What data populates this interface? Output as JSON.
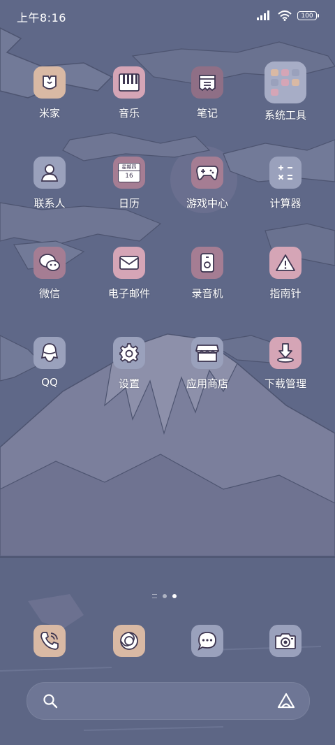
{
  "status_bar": {
    "time": "上午8:16",
    "battery": "100"
  },
  "apps": [
    {
      "label": "米家",
      "icon": "mijia-icon",
      "bg": "#d9b9a4"
    },
    {
      "label": "音乐",
      "icon": "piano-icon",
      "bg": "#d5a5b6"
    },
    {
      "label": "笔记",
      "icon": "notes-icon",
      "bg": "#8f6f86"
    },
    {
      "label": "系统工具",
      "icon": "folder-icon",
      "bg": "#a7adc6"
    },
    {
      "label": "联系人",
      "icon": "person-icon",
      "bg": "#9aa1bc"
    },
    {
      "label": "日历",
      "icon": "calendar-icon",
      "bg": "#a57d93"
    },
    {
      "label": "游戏中心",
      "icon": "gamepad-icon",
      "bg": "#a57d93"
    },
    {
      "label": "计算器",
      "icon": "calculator-icon",
      "bg": "#9aa1bc"
    },
    {
      "label": "微信",
      "icon": "wechat-icon",
      "bg": "#a57d93"
    },
    {
      "label": "电子邮件",
      "icon": "mail-icon",
      "bg": "#d5a5b6"
    },
    {
      "label": "录音机",
      "icon": "recorder-icon",
      "bg": "#a57d93"
    },
    {
      "label": "指南针",
      "icon": "compass-icon",
      "bg": "#d5a5b6"
    },
    {
      "label": "QQ",
      "icon": "qq-icon",
      "bg": "#9aa1bc"
    },
    {
      "label": "设置",
      "icon": "gear-icon",
      "bg": "#9aa1bc"
    },
    {
      "label": "应用商店",
      "icon": "store-icon",
      "bg": "#9aa1bc"
    },
    {
      "label": "下载管理",
      "icon": "download-icon",
      "bg": "#d5a5b6"
    }
  ],
  "calendar_icon": {
    "weekday": "星期四",
    "day": "16"
  },
  "dock": [
    {
      "icon": "phone-icon",
      "bg": "#d9b9a4"
    },
    {
      "icon": "browser-icon",
      "bg": "#d9b9a4"
    },
    {
      "icon": "message-icon",
      "bg": "#9aa1bc"
    },
    {
      "icon": "camera-icon",
      "bg": "#9aa1bc"
    }
  ],
  "page_indicator": {
    "current": 2,
    "total": 2
  }
}
